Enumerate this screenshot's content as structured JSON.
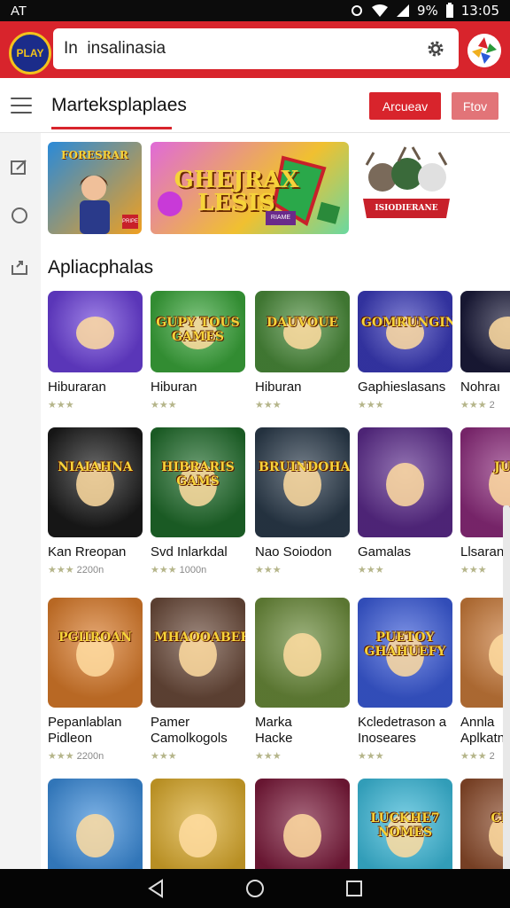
{
  "status_bar": {
    "carrier": "AT",
    "battery": "9%",
    "time": "13:05"
  },
  "header": {
    "logo_text": "PLAY",
    "search_value": "In  insalinasia"
  },
  "title_bar": {
    "title": "Marteksplaplaes",
    "primary_button": "Arcueav",
    "secondary_button": "Ftov"
  },
  "featured": [
    {
      "text": "FORESRAR",
      "badge": "PRIPE",
      "color": "#f29a1d"
    },
    {
      "text": "GHEJRAX LESIS",
      "badge": "RIAME",
      "color": "#f0c030"
    },
    {
      "text": "ISIODIERANE",
      "badge": "",
      "color": "#c8202a"
    }
  ],
  "section": {
    "title": "Apliacphalas"
  },
  "apps": [
    {
      "name": "Hiburaran",
      "meta_stars": "★★★",
      "meta_extra": "",
      "icon_text": "",
      "bg": "#6a3fd8"
    },
    {
      "name": "Hiburan",
      "meta_stars": "★★★",
      "meta_extra": "",
      "icon_text": "GUPY TOUS GAMES",
      "bg": "#3ba53b"
    },
    {
      "name": "Hiburan",
      "meta_stars": "★★★",
      "meta_extra": "",
      "icon_text": "DAUVOUE",
      "bg": "#4a8a3a"
    },
    {
      "name": "Gaphieslasans",
      "meta_stars": "★★★",
      "meta_extra": "",
      "icon_text": "GOMRUNGINS",
      "bg": "#3a3ab8"
    },
    {
      "name": "Nohraı",
      "meta_stars": "★★★",
      "meta_extra": "2",
      "icon_text": "",
      "bg": "#1b1b3a"
    },
    {
      "name": "Kan Rreopan",
      "meta_stars": "★★★",
      "meta_extra": "2200n",
      "icon_text": "NIAIAHNA",
      "bg": "#1a1a1a"
    },
    {
      "name": "Svd Inlarkdal",
      "meta_stars": "★★★",
      "meta_extra": "1000n",
      "icon_text": "HIBRARIS GAMS",
      "bg": "#1f6a2a"
    },
    {
      "name": "Nao Soiodon",
      "meta_stars": "★★★",
      "meta_extra": "",
      "icon_text": "BRUINDOHAK",
      "bg": "#2a3a4a"
    },
    {
      "name": "Gamalas",
      "meta_stars": "★★★",
      "meta_extra": "",
      "icon_text": "",
      "bg": "#5a2a8a"
    },
    {
      "name": "Llsaran",
      "meta_stars": "★★★",
      "meta_extra": "",
      "icon_text": "JUG",
      "bg": "#8a2a7a"
    },
    {
      "name": "Pepanlablan",
      "name2": "Pidleon",
      "meta_stars": "★★★",
      "meta_extra": "2200n",
      "icon_text": "PGIIROAN",
      "bg": "#d87a2a"
    },
    {
      "name": "Pamer",
      "name2": "Camolkogols",
      "meta_stars": "★★★",
      "meta_extra": "",
      "icon_text": "MHAOOABEE",
      "bg": "#6a4a3a"
    },
    {
      "name": "Marka",
      "name2": "Hacke",
      "meta_stars": "★★★",
      "meta_extra": "",
      "icon_text": "",
      "bg": "#6a8a3a"
    },
    {
      "name": "Kcledetrason a",
      "name2": "Inoseares",
      "meta_stars": "★★★",
      "meta_extra": "",
      "icon_text": "PUETOY GHAHUEFY",
      "bg": "#3a5ad8"
    },
    {
      "name": "Annla",
      "name2": "Aplkatn",
      "meta_stars": "★★★",
      "meta_extra": "2",
      "icon_text": "",
      "bg": "#c87a3a"
    },
    {
      "name": "",
      "meta_stars": "",
      "meta_extra": "",
      "icon_text": "",
      "bg": "#3a8ad8"
    },
    {
      "name": "",
      "meta_stars": "",
      "meta_extra": "",
      "icon_text": "",
      "bg": "#d8a82a"
    },
    {
      "name": "",
      "meta_stars": "",
      "meta_extra": "",
      "icon_text": "",
      "bg": "#7a1a3a"
    },
    {
      "name": "",
      "meta_stars": "",
      "meta_extra": "",
      "icon_text": "LUCKHE7 NOMES",
      "bg": "#3ab8d8"
    },
    {
      "name": "",
      "meta_stars": "",
      "meta_extra": "",
      "icon_text": "CITA",
      "bg": "#8a4a2a"
    }
  ],
  "colors": {
    "accent": "#d8242c",
    "accent_light": "#e27478"
  },
  "icons": [
    "menu-icon",
    "settings-icon",
    "edit-icon",
    "circle-icon",
    "share-icon",
    "back-icon",
    "home-icon",
    "recents-icon"
  ]
}
